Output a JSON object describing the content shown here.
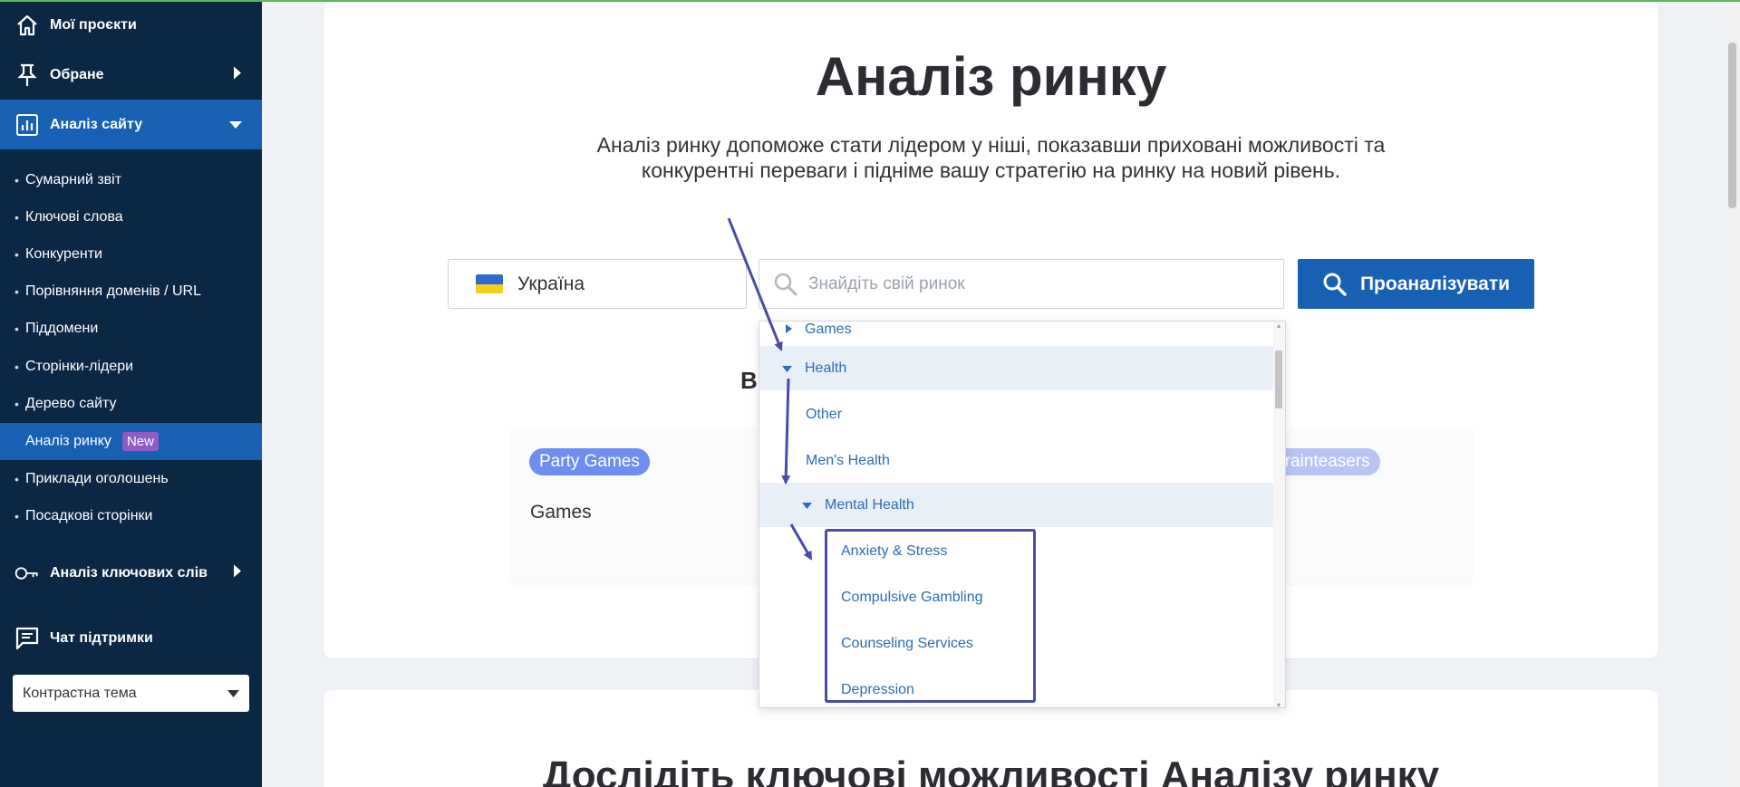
{
  "sidebar": {
    "nav": [
      {
        "label": "Мої проєкти",
        "icon": "home-icon"
      },
      {
        "label": "Обране",
        "icon": "pin-icon"
      },
      {
        "label": "Аналіз сайту",
        "icon": "analytics-icon"
      }
    ],
    "sub_items": [
      "Сумарний звіт",
      "Ключові слова",
      "Конкуренти",
      "Порівняння доменів / URL",
      "Піддомени",
      "Сторінки-лідери",
      "Дерево сайту",
      "Аналіз ринку",
      "Приклади оголошень",
      "Посадкові сторінки"
    ],
    "new_badge": "New",
    "keyword_analysis": {
      "label": "Аналіз ключових слів",
      "icon": "key-icon"
    },
    "support_chat": {
      "label": "Чат підтримки",
      "icon": "chat-icon"
    },
    "theme_select": "Контрастна тема"
  },
  "hero": {
    "title": "Аналіз ринку",
    "description": "Аналіз ринку допоможе стати лідером у ніші, показавши приховані можливості та конкурентні переваги і підніме вашу стратегію на ринку на новий рівень.",
    "country": "Україна",
    "search_placeholder": "Знайдіть свій ринок",
    "analyze_button": "Проаналізувати",
    "partial_heading": "Ві"
  },
  "category_card": {
    "pill_1": "Party Games",
    "pill_2": "Brainteasers",
    "category": "Games"
  },
  "dropdown": {
    "rows": [
      {
        "label": "Games",
        "expander": "right"
      },
      {
        "label": "Health",
        "expander": "down"
      },
      {
        "label": "Other"
      },
      {
        "label": "Men's Health"
      },
      {
        "label": "Mental Health",
        "expander": "down"
      },
      {
        "label": "Anxiety & Stress"
      },
      {
        "label": "Compulsive Gambling"
      },
      {
        "label": "Counseling Services"
      },
      {
        "label": "Depression"
      }
    ]
  },
  "bottom": {
    "title": "Дослідіть ключові можливості Аналізу ринку"
  },
  "colors": {
    "sidebar_bg": "#0a2744",
    "accent": "#1760b3",
    "new_badge": "#8e5cc4",
    "annotation": "#4a4aa8"
  }
}
